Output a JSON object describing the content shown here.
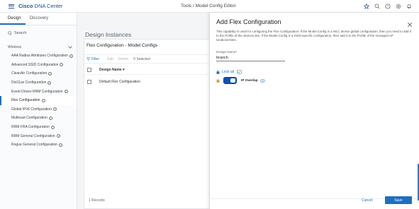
{
  "app": {
    "brand_prefix": "Cisco",
    "brand_name": "DNA Center",
    "breadcrumb": "Tools / Model Config Editor"
  },
  "sidebar": {
    "tabs": [
      {
        "label": "Design"
      },
      {
        "label": "Discovery"
      }
    ],
    "search_label": "Search",
    "section_label": "Wireless",
    "items": [
      {
        "label": "AAA Radius Attributes Configuration"
      },
      {
        "label": "Advanced SSID Configuration"
      },
      {
        "label": "CleanAir Configuration"
      },
      {
        "label": "Dot11ax Configuration"
      },
      {
        "label": "Event Driven RRM Configuration"
      },
      {
        "label": "Flex Configuration"
      },
      {
        "label": "Global IPv6 Configuration"
      },
      {
        "label": "Multicast Configuration"
      },
      {
        "label": "RRM FRA Configuration"
      },
      {
        "label": "RRM General Configuration"
      },
      {
        "label": "Rogue General Configuration"
      }
    ]
  },
  "main": {
    "title": "Design Instances",
    "card_title": "Flex Configuration - Model Configs",
    "toolbar": {
      "filter_label": "Filter",
      "edit_label": "Edit",
      "delete_label": "Delete",
      "selected_label": "0 Selected"
    },
    "table": {
      "columns": [
        "Design Name"
      ],
      "rows": [
        {
          "name": "Default Flex Configuration"
        }
      ]
    },
    "records_label": "1 Records"
  },
  "panel": {
    "title": "Add Flex Configuration",
    "description": "This capability is used for configuring the Flex Configuration. If the Model Config is a WLC device global configuration, then you need to add it to the Profile of the devices site. If the Model Config is a SSID-specific configuration, then add it to the Profile of the managed AP locations/sites.",
    "design_name_label": "Design Name*",
    "design_name_value": "branch",
    "lock_all_label": "Lock all",
    "ip_overlap_label": "IP Overlap",
    "ip_overlap_enabled": true,
    "cancel_label": "Cancel",
    "save_label": "Save",
    "accent_color": "#1f6fbf"
  },
  "icons": [
    "menu-icon",
    "star-icon",
    "search-icon",
    "help-icon",
    "settings-icon",
    "notifications-icon",
    "close-icon",
    "filter-icon",
    "lock-icon",
    "info-icon",
    "chevron-down-icon"
  ]
}
